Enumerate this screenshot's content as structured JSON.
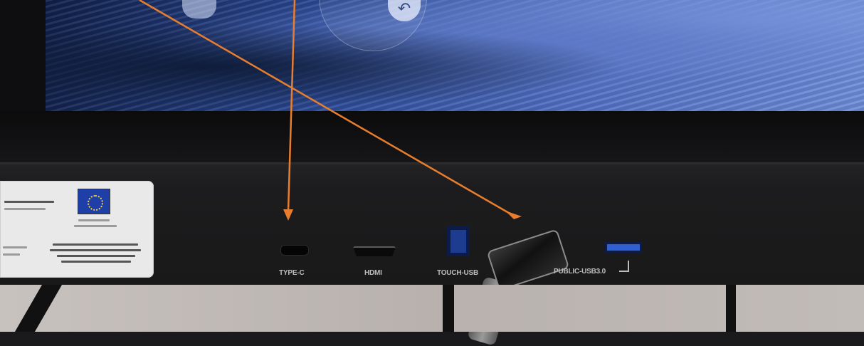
{
  "ports": [
    {
      "id": "type-c",
      "label": "TYPE-C"
    },
    {
      "id": "hdmi",
      "label": "HDMI"
    },
    {
      "id": "touch-usb",
      "label": "TOUCH-USB"
    },
    {
      "id": "public-usb3",
      "label": "PUBLIC-USB3.0"
    }
  ],
  "annotations": {
    "arrow_color": "#E87E2D"
  },
  "colors": {
    "screen_blue": "#4A68B8",
    "port_blue": "#2F5FD0",
    "panel": "#1C1C1E",
    "sticker": "#E9E9EA",
    "eu_flag": "#1E3FA8"
  },
  "icons": [
    "back-arrow-icon",
    "eu-flag-icon"
  ]
}
